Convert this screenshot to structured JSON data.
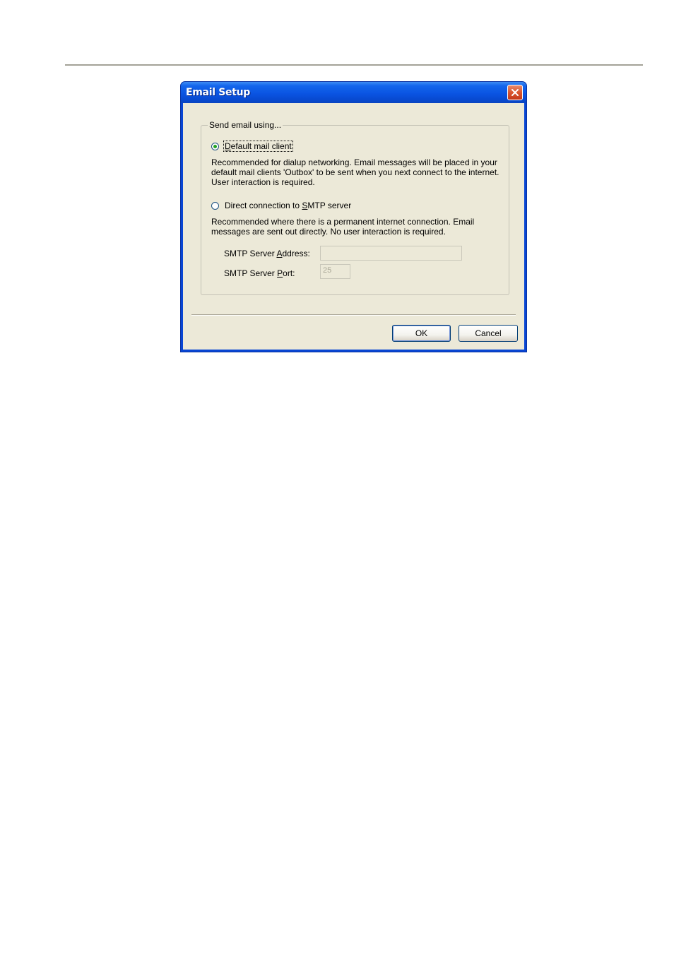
{
  "dialog": {
    "title": "Email Setup",
    "close_icon": "close-icon",
    "group_label": "Send email using...",
    "option_default": {
      "prefix": "",
      "mnemonic": "D",
      "rest": "efault mail client",
      "checked": true,
      "description": "Recommended for dialup networking. Email messages will be placed in your default mail clients 'Outbox' to be sent when you next connect to the internet. User interaction is required."
    },
    "option_smtp": {
      "prefix": "Direct connection to ",
      "mnemonic": "S",
      "rest": "MTP server",
      "checked": false,
      "description": "Recommended where there is a permanent internet connection. Email messages are sent out directly. No user interaction is required."
    },
    "smtp_address": {
      "label_prefix": "SMTP Server ",
      "label_mnemonic": "A",
      "label_rest": "ddress:",
      "value": ""
    },
    "smtp_port": {
      "label_prefix": "SMTP Server ",
      "label_mnemonic": "P",
      "label_rest": "ort:",
      "value": "25"
    },
    "ok_label": "OK",
    "cancel_label": "Cancel"
  },
  "colors": {
    "title_bar": "#0a54e2",
    "client_bg": "#ece9d8",
    "radio_dot": "#21a121",
    "close_button": "#d9552f"
  }
}
